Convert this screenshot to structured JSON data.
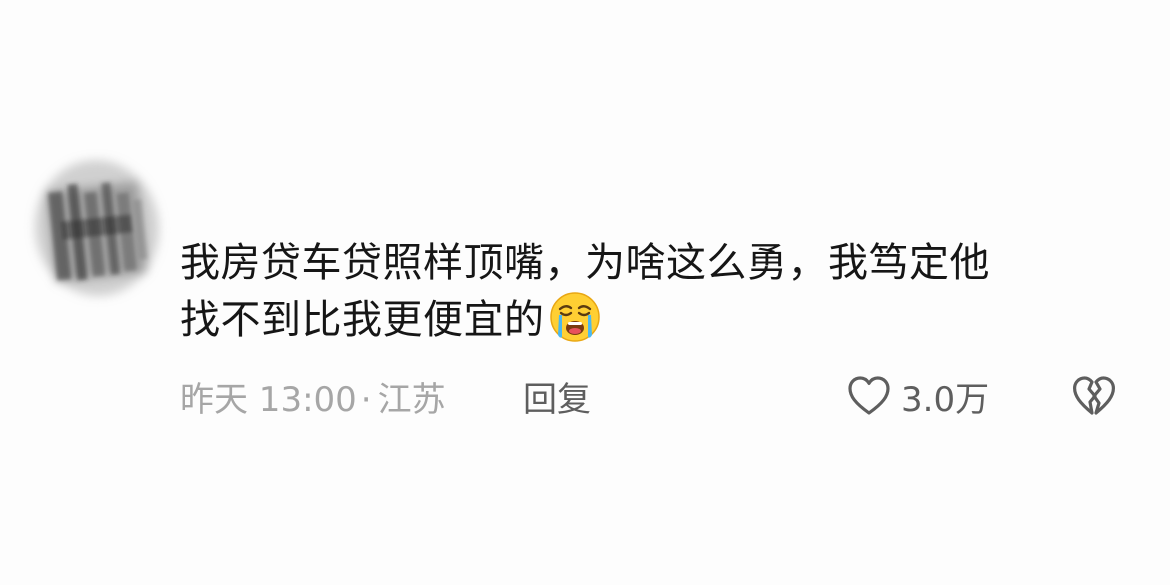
{
  "comment": {
    "text_line1": "我房贷车贷照样顶嘴，为啥这么勇，我笃定他",
    "text_line2": "找不到比我更便宜的",
    "emoji": "loudly-crying-face",
    "time": "昨天 13:00",
    "separator": "·",
    "location": "江苏",
    "reply_label": "回复",
    "like_count": "3.0万"
  },
  "colors": {
    "text": "#161616",
    "meta": "#a6a6a6",
    "action": "#5e5e5e",
    "background": "#fdfdfd"
  }
}
